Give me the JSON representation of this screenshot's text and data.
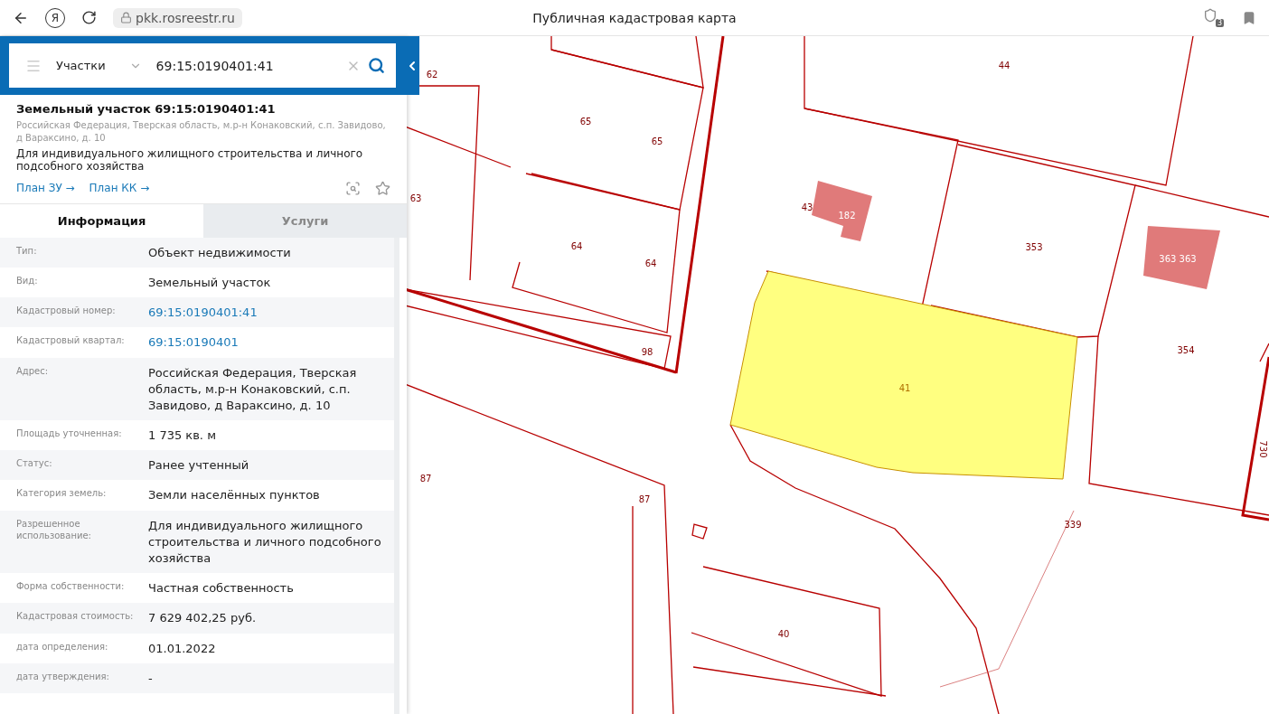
{
  "browser": {
    "logo": "Я",
    "url": "pkk.rosreestr.ru",
    "title": "Публичная кадастровая карта",
    "shield_badge": "3"
  },
  "search": {
    "category": "Участки",
    "value": "69:15:0190401:41"
  },
  "card": {
    "title": "Земельный участок 69:15:0190401:41",
    "address": "Российская Федерация, Тверская область, м.р-н Конаковский, с.п. Завидово, д Вараксино, д. 10",
    "purpose": "Для индивидуального жилищного строительства и личного подсобного хозяйства",
    "links": [
      "План ЗУ →",
      "План КК →"
    ]
  },
  "tabs": [
    {
      "label": "Информация",
      "selected": true
    },
    {
      "label": "Услуги",
      "selected": false
    }
  ],
  "rows": [
    {
      "label": "Тип:",
      "value": "Объект недвижимости",
      "kind": "text"
    },
    {
      "label": "Вид:",
      "value": "Земельный участок",
      "kind": "text"
    },
    {
      "label": "Кадастровый номер:",
      "value": "69:15:0190401:41",
      "kind": "link"
    },
    {
      "label": "Кадастровый квартал:",
      "value": "69:15:0190401",
      "kind": "link"
    },
    {
      "label": "Адрес:",
      "value": "Российская Федерация, Тверская область, м.р-н Конаковский, с.п. Завидово, д Вараксино, д. 10",
      "kind": "text"
    },
    {
      "label": "Площадь уточненная:",
      "value": "1 735 кв. м",
      "kind": "text"
    },
    {
      "label": "Статус:",
      "value": "Ранее учтенный",
      "kind": "text"
    },
    {
      "label": "Категория земель:",
      "value": "Земли населённых пунктов",
      "kind": "text"
    },
    {
      "label": "Разрешенное использование:",
      "value": "Для индивидуального жилищного строительства и личного подсобного хозяйства",
      "kind": "text"
    },
    {
      "label": "Форма собственности:",
      "value": "Частная собственность",
      "kind": "text"
    },
    {
      "label": "Кадастровая стоимость:",
      "value": "7 629 402,25 руб.",
      "kind": "text"
    },
    {
      "label": "дата определения:",
      "value": "01.01.2022",
      "kind": "text"
    },
    {
      "label": "дата утверждения:",
      "value": "-",
      "kind": "text"
    }
  ],
  "map": {
    "labels": [
      "62",
      "44",
      "65",
      "65",
      "63",
      "43",
      "182",
      "353",
      "363 363",
      "64",
      "64",
      "98",
      "354",
      "41",
      "87",
      "87",
      "730",
      "339",
      "40"
    ]
  }
}
